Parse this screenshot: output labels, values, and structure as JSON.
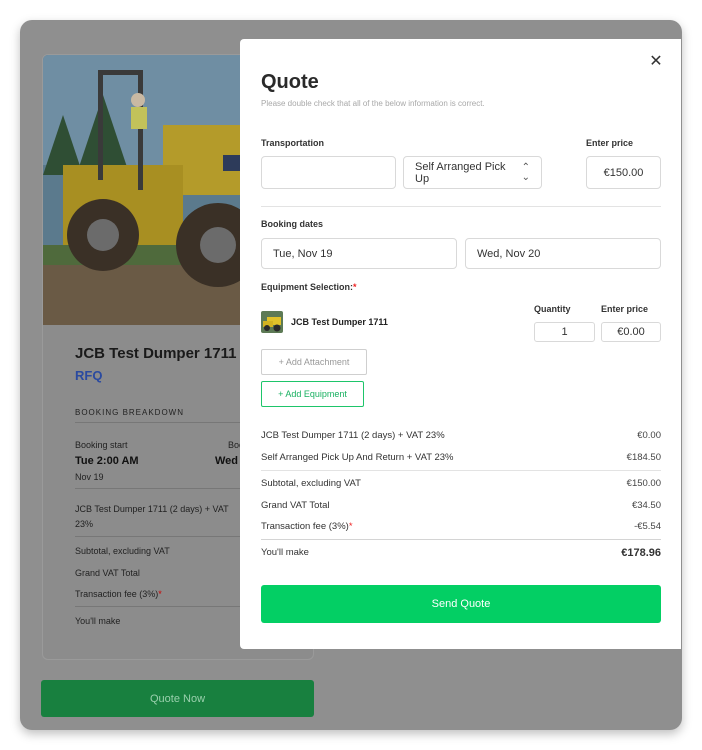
{
  "background": {
    "title": "JCB Test Dumper 1711",
    "rfq": "RFQ",
    "section": "BOOKING BREAKDOWN",
    "booking_start_label": "Booking start",
    "booking_start_time": "Tue 2:00 AM",
    "booking_start_date": "Nov 19",
    "booking_end_label": "Boo",
    "booking_end_time": "Wed 2",
    "line_item_1": "JCB Test Dumper 1711 (2 days) + VAT",
    "line_item_2": "23%",
    "subtotal": "Subtotal, excluding VAT",
    "grand_vat": "Grand VAT Total",
    "fee": "Transaction fee (3%)",
    "fee_req": "*",
    "youll_make": "You'll make",
    "quote_now": "Quote Now"
  },
  "modal": {
    "close": "✕",
    "title": "Quote",
    "subtitle": "Please double check that all of the below information is correct.",
    "transportation_label": "Transportation",
    "transportation_input": "",
    "transport_option": "Self Arranged Pick Up",
    "enter_price_label": "Enter price",
    "transport_price": "€150.00",
    "booking_dates_label": "Booking dates",
    "start_date": "Tue, Nov 19",
    "end_date": "Wed, Nov 20",
    "equipment_label": "Equipment Selection:",
    "equipment_req": "*",
    "quantity_label": "Quantity",
    "equipment_price_label": "Enter price",
    "equipment_name": "JCB Test Dumper 1711",
    "quantity": "1",
    "equipment_price": "€0.00",
    "add_attachment": "+ Add Attachment",
    "add_equipment": "+ Add Equipment",
    "summary": [
      {
        "label": "JCB Test Dumper 1711 (2 days) + VAT 23%",
        "value": "€0.00"
      },
      {
        "label": "Self Arranged Pick Up And Return + VAT 23%",
        "value": "€184.50"
      },
      {
        "label": "Subtotal, excluding VAT",
        "value": "€150.00"
      },
      {
        "label": "Grand VAT Total",
        "value": "€34.50"
      },
      {
        "label": "Transaction fee (3%)",
        "value": "-€5.54"
      },
      {
        "label": "You'll make",
        "value": "€178.96"
      }
    ],
    "send_quote": "Send Quote"
  },
  "colors": {
    "accent_green": "#03cf64",
    "overlay": "#8f8f8f",
    "rfq_blue": "#2a4aa0"
  }
}
